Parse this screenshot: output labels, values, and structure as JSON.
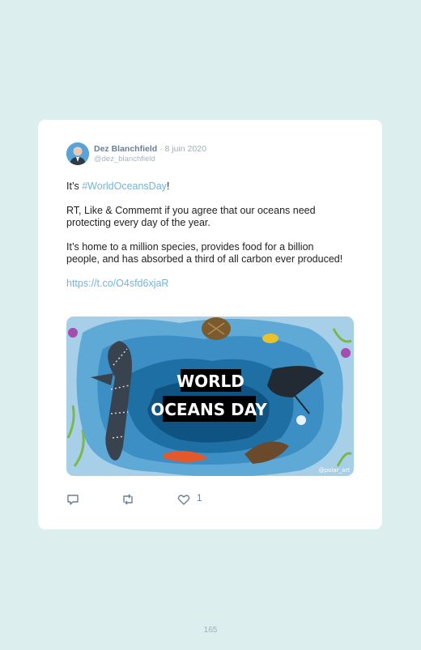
{
  "tweet": {
    "author_name": "Dez Blanchfield",
    "separator": " · ",
    "date": "8 juin 2020",
    "handle": "@dez_blanchfield",
    "line1_before": "It’s ",
    "line1_hashtag": "#WorldOceansDay",
    "line1_after": "!",
    "paragraph2": "RT, Like & Commemt if you agree that our oceans need protecting every day of the year.",
    "paragraph3": "It’s home to a million species, provides food for a billion people, and has absorbed a third of all carbon ever produced!",
    "link": "https://t.co/O4sfd6xjaR",
    "image": {
      "title_line1": "WORLD",
      "title_line2": "OCEANS DAY",
      "credit": "@polar_art"
    },
    "actions": {
      "reply_icon": "reply-icon",
      "retweet_icon": "retweet-icon",
      "like_icon": "heart-icon",
      "like_count": "1"
    }
  },
  "page_number": "165"
}
